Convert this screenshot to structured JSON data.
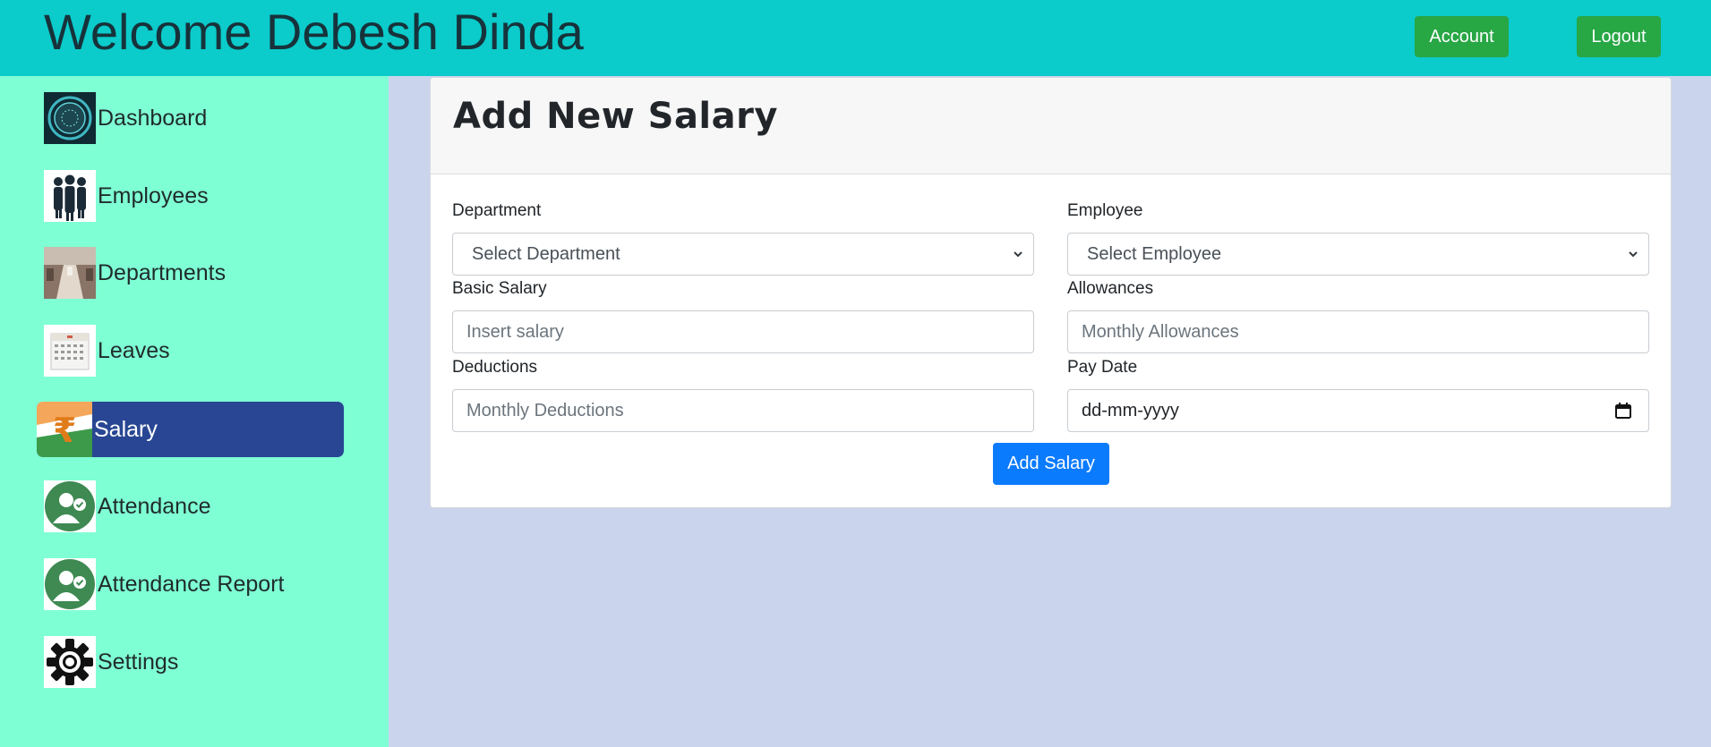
{
  "header": {
    "welcome": "Welcome Debesh Dinda",
    "account_label": "Account",
    "logout_label": "Logout"
  },
  "sidebar": {
    "items": [
      {
        "label": "Dashboard",
        "icon": "dashboard-icon"
      },
      {
        "label": "Employees",
        "icon": "employees-icon"
      },
      {
        "label": "Departments",
        "icon": "departments-icon"
      },
      {
        "label": "Leaves",
        "icon": "calendar-icon"
      },
      {
        "label": "Salary",
        "icon": "rupee-icon",
        "active": true
      },
      {
        "label": "Attendance",
        "icon": "attendance-icon"
      },
      {
        "label": "Attendance Report",
        "icon": "attendance-report-icon"
      },
      {
        "label": "Settings",
        "icon": "gear-icon"
      }
    ]
  },
  "form": {
    "title": "Add New Salary",
    "department": {
      "label": "Department",
      "selected": "Select Department"
    },
    "employee": {
      "label": "Employee",
      "selected": "Select Employee"
    },
    "basic_salary": {
      "label": "Basic Salary",
      "placeholder": "Insert salary"
    },
    "allowances": {
      "label": "Allowances",
      "placeholder": "Monthly Allowances"
    },
    "deductions": {
      "label": "Deductions",
      "placeholder": "Monthly Deductions"
    },
    "pay_date": {
      "label": "Pay Date",
      "placeholder": "dd-mm-yyyy"
    },
    "submit_label": "Add Salary"
  },
  "colors": {
    "topbar": "#0bcbcb",
    "sidebar": "#7fffd4",
    "content_bg": "#cad4ec",
    "active_item": "#284693",
    "success_button": "#28a745",
    "primary_button": "#0b7bfe"
  }
}
